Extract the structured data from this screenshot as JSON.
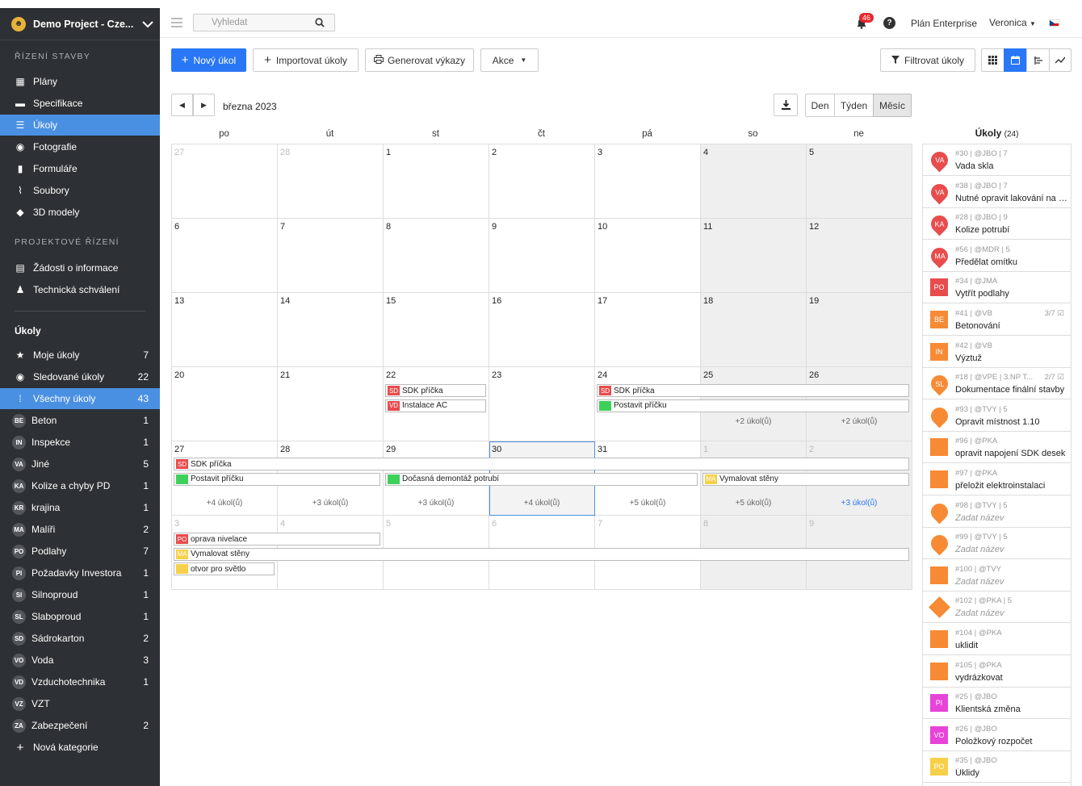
{
  "project": {
    "name": "Demo Project - Cze..."
  },
  "sidebar": {
    "section1": "ŘÍZENÍ STAVBY",
    "nav1": [
      {
        "label": "Plány",
        "icon": "map-icon"
      },
      {
        "label": "Specifikace",
        "icon": "book-icon"
      },
      {
        "label": "Úkoly",
        "icon": "list-icon",
        "active": true
      },
      {
        "label": "Fotografie",
        "icon": "camera-icon"
      },
      {
        "label": "Formuláře",
        "icon": "clipboard-icon"
      },
      {
        "label": "Soubory",
        "icon": "paperclip-icon"
      },
      {
        "label": "3D modely",
        "icon": "cube-icon"
      }
    ],
    "section2": "PROJEKTOVÉ ŘÍZENÍ",
    "nav2": [
      {
        "label": "Žádosti o informace",
        "icon": "document-icon"
      },
      {
        "label": "Technická schválení",
        "icon": "stamp-icon"
      }
    ],
    "tasks_title": "Úkoly",
    "task_nav": [
      {
        "label": "Moje úkoly",
        "count": "7",
        "icon": "star-icon"
      },
      {
        "label": "Sledované úkoly",
        "count": "22",
        "icon": "eye-icon"
      },
      {
        "label": "Všechny úkoly",
        "count": "43",
        "icon": "grid-icon",
        "active": true
      }
    ],
    "categories": [
      {
        "badge": "BE",
        "label": "Beton",
        "count": "1"
      },
      {
        "badge": "IN",
        "label": "Inspekce",
        "count": "1"
      },
      {
        "badge": "VA",
        "label": "Jiné",
        "count": "5"
      },
      {
        "badge": "KA",
        "label": "Kolize a chyby PD",
        "count": "1"
      },
      {
        "badge": "KR",
        "label": "krajina",
        "count": "1"
      },
      {
        "badge": "MA",
        "label": "Malíři",
        "count": "2"
      },
      {
        "badge": "PO",
        "label": "Podlahy",
        "count": "7"
      },
      {
        "badge": "PI",
        "label": "Požadavky Investora",
        "count": "1"
      },
      {
        "badge": "SI",
        "label": "Silnoproud",
        "count": "1"
      },
      {
        "badge": "SL",
        "label": "Slaboproud",
        "count": "1"
      },
      {
        "badge": "SD",
        "label": "Sádrokarton",
        "count": "2"
      },
      {
        "badge": "VO",
        "label": "Voda",
        "count": "3"
      },
      {
        "badge": "VD",
        "label": "Vzduchotechnika",
        "count": "1"
      },
      {
        "badge": "VZ",
        "label": "VZT",
        "count": ""
      },
      {
        "badge": "ZA",
        "label": "Zabezpečení",
        "count": "2"
      }
    ],
    "new_category": "Nová kategorie"
  },
  "topbar": {
    "search_placeholder": "Vyhledat",
    "notifications": "46",
    "plan": "Plán Enterprise",
    "user": "Veronica",
    "help": "?"
  },
  "toolbar": {
    "new_task": "Nový úkol",
    "import": "Importovat úkoly",
    "generate": "Generovat výkazy",
    "actions": "Akce",
    "filter": "Filtrovat úkoly"
  },
  "calendar": {
    "month": "března 2023",
    "views": [
      "Den",
      "Týden",
      "Měsíc"
    ],
    "weekdays": [
      "po",
      "út",
      "st",
      "čt",
      "pá",
      "so",
      "ne"
    ],
    "weeks": [
      [
        "27",
        "28",
        "1",
        "2",
        "3",
        "4",
        "5"
      ],
      [
        "6",
        "7",
        "8",
        "9",
        "10",
        "11",
        "12"
      ],
      [
        "13",
        "14",
        "15",
        "16",
        "17",
        "18",
        "19"
      ],
      [
        "20",
        "21",
        "22",
        "23",
        "24",
        "25",
        "26"
      ],
      [
        "27",
        "28",
        "29",
        "30",
        "31",
        "1",
        "2"
      ],
      [
        "3",
        "4",
        "5",
        "6",
        "7",
        "8",
        "9"
      ]
    ],
    "events": [
      {
        "w": 3,
        "c1": 2,
        "c2": 2,
        "row": 0,
        "tag": "SD",
        "color": "#e84c4c",
        "title": "SDK příčka"
      },
      {
        "w": 3,
        "c1": 2,
        "c2": 2,
        "row": 1,
        "tag": "VD",
        "color": "#e84c4c",
        "title": "Instalace AC"
      },
      {
        "w": 3,
        "c1": 4,
        "c2": 6,
        "row": 0,
        "tag": "SD",
        "color": "#e84c4c",
        "title": "SDK příčka",
        "arrow": true
      },
      {
        "w": 3,
        "c1": 4,
        "c2": 6,
        "row": 1,
        "tag": "",
        "color": "#3ed15a",
        "title": "Postavit příčku",
        "arrow": true
      },
      {
        "w": 4,
        "c1": 0,
        "c2": 6,
        "row": 0,
        "tag": "SD",
        "color": "#e84c4c",
        "title": "SDK příčka",
        "larrow": true
      },
      {
        "w": 4,
        "c1": 0,
        "c2": 1,
        "row": 1,
        "tag": "",
        "color": "#3ed15a",
        "title": "Postavit příčku",
        "larrow": true
      },
      {
        "w": 4,
        "c1": 2,
        "c2": 4,
        "row": 1,
        "tag": "",
        "color": "#3ed15a",
        "title": "Dočasná demontáž potrubí"
      },
      {
        "w": 4,
        "c1": 5,
        "c2": 6,
        "row": 1,
        "tag": "MA",
        "color": "#f7d04a",
        "title": "Vymalovat stěny",
        "arrow": true
      },
      {
        "w": 5,
        "c1": 0,
        "c2": 1,
        "row": 0,
        "tag": "PO",
        "color": "#e84c4c",
        "title": "oprava nivelace",
        "larrow": true
      },
      {
        "w": 5,
        "c1": 0,
        "c2": 6,
        "row": 1,
        "tag": "MA",
        "color": "#f7d04a",
        "title": "Vymalovat stěny",
        "larrow": true
      },
      {
        "w": 5,
        "c1": 0,
        "c2": 0,
        "row": 2,
        "tag": "",
        "color": "#f7d04a",
        "title": "otvor pro světlo",
        "larrow": true
      }
    ],
    "more": [
      {
        "w": 3,
        "c": 5,
        "text": "+2 úkol(ů)"
      },
      {
        "w": 3,
        "c": 6,
        "text": "+2 úkol(ů)"
      },
      {
        "w": 4,
        "c": 0,
        "text": "+4 úkol(ů)"
      },
      {
        "w": 4,
        "c": 1,
        "text": "+3 úkol(ů)"
      },
      {
        "w": 4,
        "c": 2,
        "text": "+3 úkol(ů)"
      },
      {
        "w": 4,
        "c": 3,
        "text": "+4 úkol(ů)"
      },
      {
        "w": 4,
        "c": 4,
        "text": "+5 úkol(ů)"
      },
      {
        "w": 4,
        "c": 5,
        "text": "+5 úkol(ů)"
      },
      {
        "w": 4,
        "c": 6,
        "text": "+3 úkol(ů)",
        "link": true
      }
    ]
  },
  "task_panel": {
    "title": "Úkoly",
    "count": "(24)",
    "items": [
      {
        "meta": "#30 | @JBO | 7",
        "name": "Vada skla",
        "shape": "pin",
        "tag": "VA",
        "color": "#e84c4c"
      },
      {
        "meta": "#38 | @JBO | 7",
        "name": "Nutné opravit lakování na z...",
        "shape": "pin",
        "tag": "VA",
        "color": "#e84c4c"
      },
      {
        "meta": "#28 | @JBO | 9",
        "name": "Kolize potrubí",
        "shape": "pin",
        "tag": "KA",
        "color": "#e84c4c"
      },
      {
        "meta": "#56 | @MDR | 5",
        "name": "Předělat omítku",
        "shape": "pin",
        "tag": "MA",
        "color": "#e84c4c"
      },
      {
        "meta": "#34 | @JMA",
        "name": "Vytřít podlahy",
        "shape": "square",
        "tag": "PO",
        "color": "#e84c4c"
      },
      {
        "meta": "#41 | @VB",
        "name": "Betonování",
        "shape": "square",
        "tag": "BE",
        "color": "#f78a35",
        "progress": "3/7 ☑"
      },
      {
        "meta": "#42 | @VB",
        "name": "Výztuž",
        "shape": "square",
        "tag": "IN",
        "color": "#f78a35"
      },
      {
        "meta": "#18 | @VPE | 3.NP T...",
        "name": "Dokumentace finální stavby",
        "shape": "pin",
        "tag": "SL",
        "color": "#f78a35",
        "progress": "2/7 ☑"
      },
      {
        "meta": "#93 | @TVY | 5",
        "name": "Opravit místnost 1.10",
        "shape": "pin",
        "tag": "",
        "color": "#f78a35"
      },
      {
        "meta": "#96 | @PKA",
        "name": "opravit napojení SDK desek",
        "shape": "square",
        "tag": "",
        "color": "#f78a35"
      },
      {
        "meta": "#97 | @PKA",
        "name": "přeložit elektroinstalaci",
        "shape": "square",
        "tag": "",
        "color": "#f78a35"
      },
      {
        "meta": "#98 | @TVY | 5",
        "name": "Zadat název",
        "shape": "pin",
        "tag": "",
        "color": "#f78a35",
        "placeholder": true
      },
      {
        "meta": "#99 | @TVY | 5",
        "name": "Zadat název",
        "shape": "pin",
        "tag": "",
        "color": "#f78a35",
        "placeholder": true
      },
      {
        "meta": "#100 | @TVY",
        "name": "Zadat název",
        "shape": "square",
        "tag": "",
        "color": "#f78a35",
        "placeholder": true
      },
      {
        "meta": "#102 | @PKA | 5",
        "name": "Zadat název",
        "shape": "diamond",
        "tag": "",
        "color": "#f78a35",
        "placeholder": true
      },
      {
        "meta": "#104 | @PKA",
        "name": "uklidit",
        "shape": "square",
        "tag": "",
        "color": "#f78a35"
      },
      {
        "meta": "#105 | @PKA",
        "name": "vydrázkovat",
        "shape": "square",
        "tag": "",
        "color": "#f78a35"
      },
      {
        "meta": "#25 | @JBO",
        "name": "Klientská změna",
        "shape": "square",
        "tag": "PI",
        "color": "#e843d8"
      },
      {
        "meta": "#26 | @JBO",
        "name": "Položkový rozpočet",
        "shape": "square",
        "tag": "VO",
        "color": "#e843d8"
      },
      {
        "meta": "#35 | @JBO",
        "name": "Úklidy",
        "shape": "square",
        "tag": "PO",
        "color": "#f7d04a"
      }
    ]
  }
}
